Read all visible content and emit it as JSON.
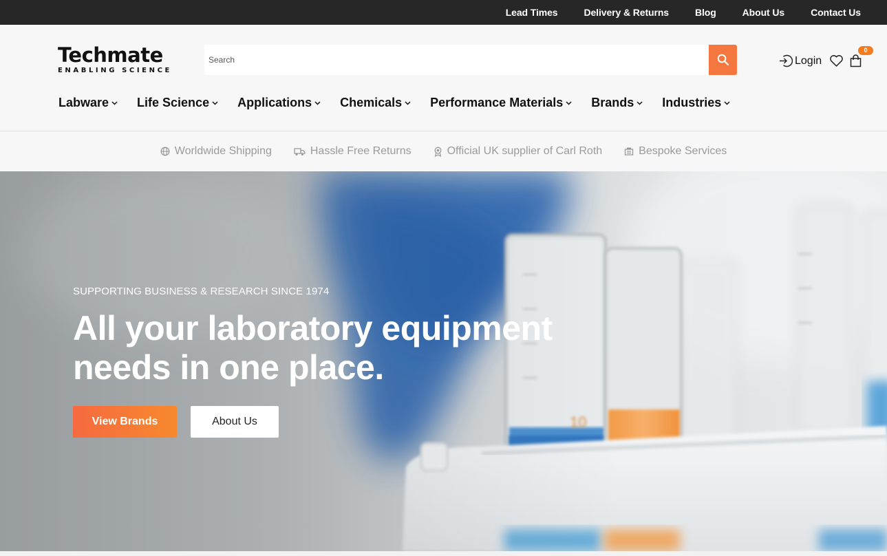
{
  "topbar": {
    "links": [
      "Lead Times",
      "Delivery & Returns",
      "Blog",
      "About Us",
      "Contact Us"
    ]
  },
  "header": {
    "logo_main": "Techmate",
    "logo_sub": "ENABLING SCIENCE",
    "search_placeholder": "Search",
    "login_label": "Login",
    "cart_count": "0"
  },
  "nav": {
    "items": [
      "Labware",
      "Life Science",
      "Applications",
      "Chemicals",
      "Performance Materials",
      "Brands",
      "Industries"
    ]
  },
  "benefits": {
    "items": [
      {
        "label": "Worldwide Shipping",
        "icon": "globe-icon"
      },
      {
        "label": "Hassle Free Returns",
        "icon": "truck-icon"
      },
      {
        "label": "Official UK supplier of Carl Roth",
        "icon": "award-icon"
      },
      {
        "label": "Bespoke Services",
        "icon": "machine-icon"
      }
    ]
  },
  "hero": {
    "eyebrow": "SUPPORTING BUSINESS & RESEARCH SINCE 1974",
    "headline": "All your laboratory equipment needs in one place.",
    "primary_button": "View Brands",
    "secondary_button": "About Us",
    "beaker_marking": "10"
  },
  "colors": {
    "accent": "#f47740",
    "topbar": "#272727",
    "header_bg": "#f7f7f7"
  }
}
